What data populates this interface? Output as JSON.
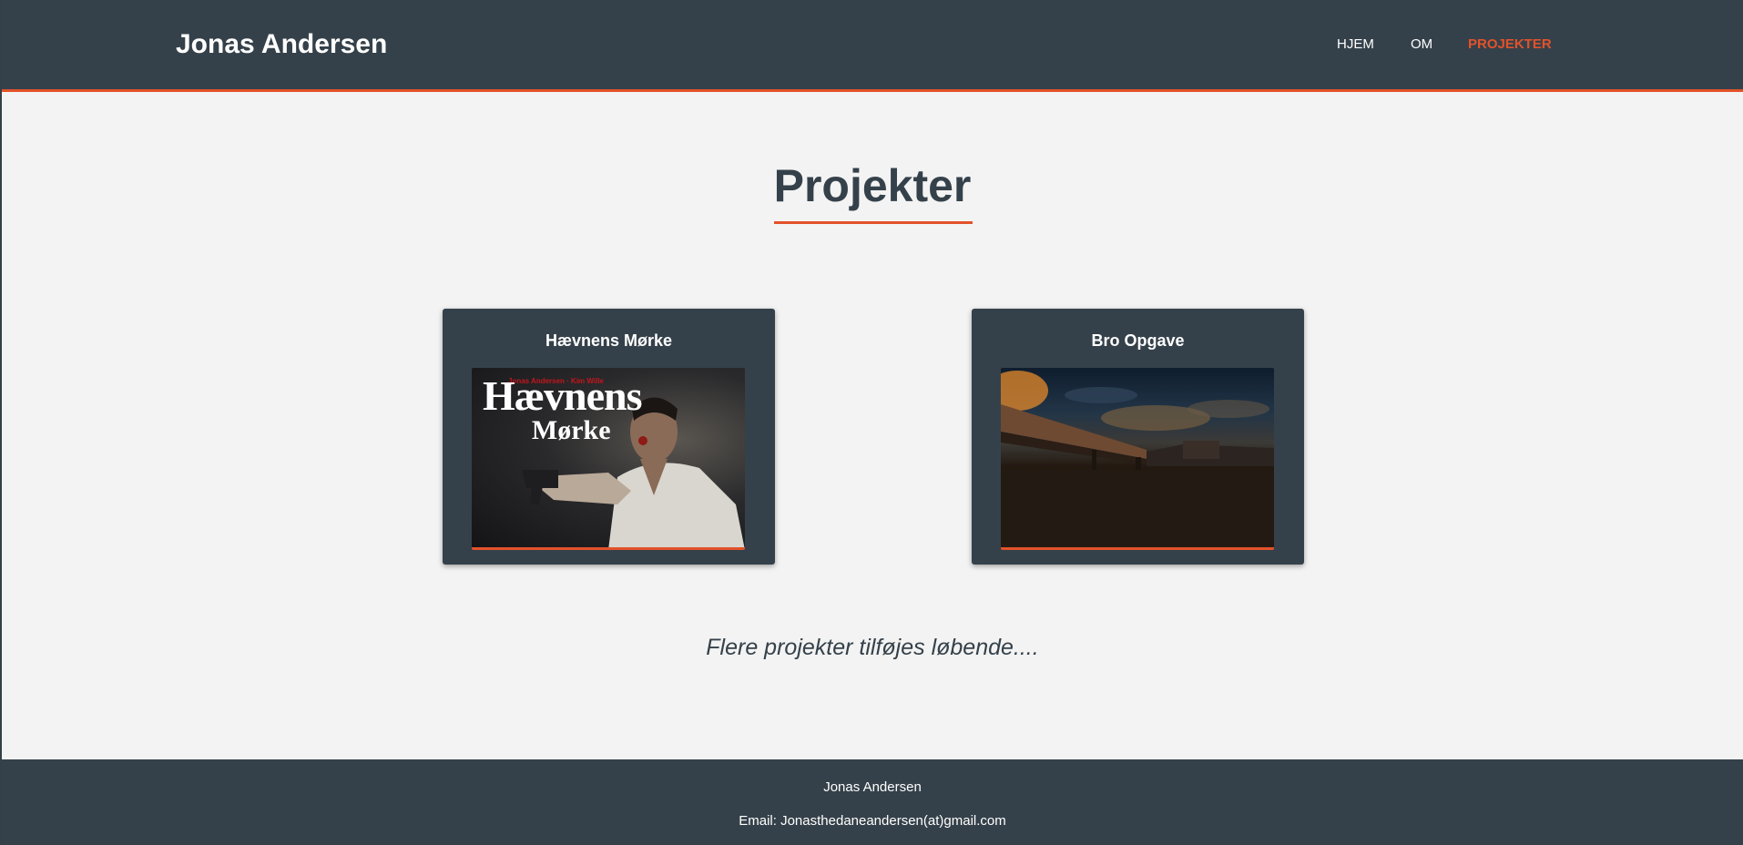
{
  "header": {
    "brand": "Jonas Andersen",
    "nav": [
      {
        "label": "HJEM",
        "active": false
      },
      {
        "label": "OM",
        "active": false
      },
      {
        "label": "PROJEKTER",
        "active": true
      }
    ],
    "accent_color": "#e3522a",
    "background_color": "#35414a"
  },
  "main": {
    "title": "Projekter",
    "projects": [
      {
        "title": "Hævnens Mørke",
        "image": "movie-poster-image",
        "poster_title_line1": "Hævnens",
        "poster_title_line2": "Mørke"
      },
      {
        "title": "Bro Opgave",
        "image": "bridge-photo-image"
      }
    ],
    "more_text": "Flere projekter tilføjes løbende...."
  },
  "footer": {
    "name": "Jonas Andersen",
    "email": "Email: Jonasthedaneandersen(at)gmail.com"
  }
}
